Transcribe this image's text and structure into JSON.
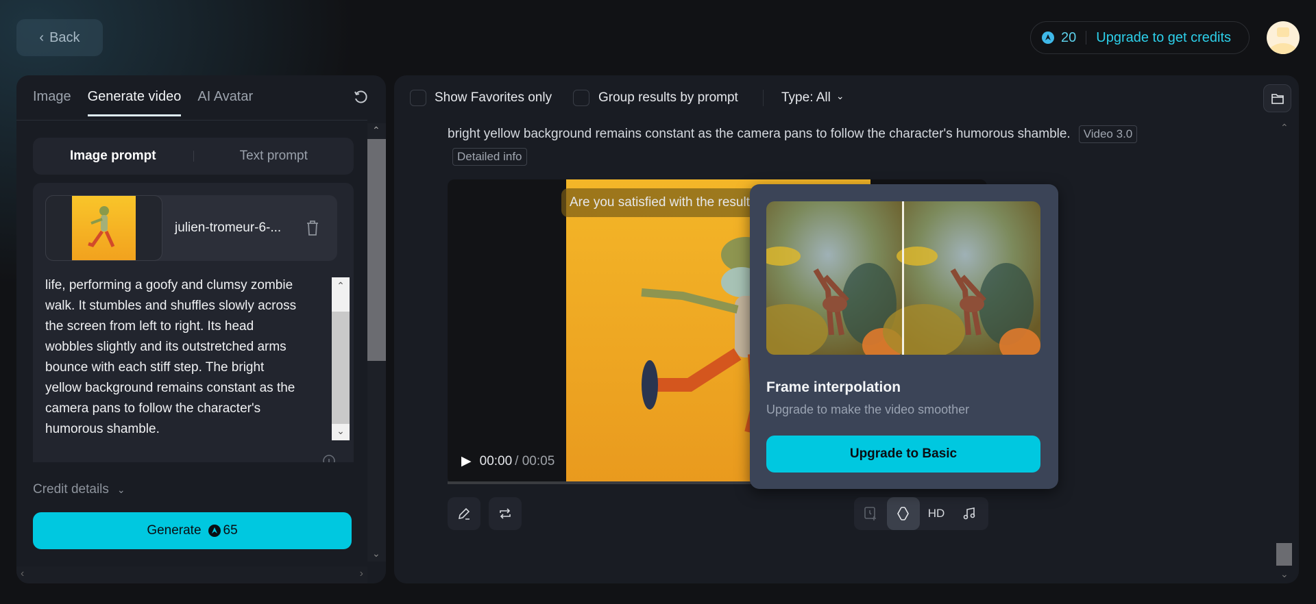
{
  "header": {
    "back_label": "Back",
    "credits": "20",
    "upgrade_label": "Upgrade to get credits"
  },
  "left": {
    "tabs": [
      "Image",
      "Generate video",
      "AI Avatar"
    ],
    "prompt_modes": [
      "Image prompt",
      "Text prompt"
    ],
    "file_name": "julien-tromeur-6-...",
    "prompt_lines": [
      "life, performing a goofy and clumsy zombie",
      "walk. It stumbles and shuffles slowly across",
      "the screen from left to right. Its head",
      "wobbles slightly and its outstretched arms",
      "bounce with each stiff step. The bright",
      "yellow background remains constant as the",
      "camera pans to follow the character's",
      "humorous shamble."
    ],
    "credit_details": "Credit details",
    "generate_label": "Generate",
    "generate_cost": "65"
  },
  "right": {
    "show_favorites": "Show Favorites only",
    "group_by_prompt": "Group results by prompt",
    "type_filter": "Type: All",
    "prompt_text": "bright yellow background remains constant as the camera pans to follow the character's humorous shamble.",
    "model_tag": "Video 3.0",
    "detailed_info": "Detailed info",
    "satisfied": "Are you satisfied with the results?",
    "time_current": "00:00",
    "time_total": "/ 00:05",
    "hd_label": "HD"
  },
  "popup": {
    "title": "Frame interpolation",
    "subtitle": "Upgrade to make the video smoother",
    "button": "Upgrade to Basic"
  },
  "colors": {
    "accent": "#00c8e0",
    "panel": "#191c23",
    "popup": "#3b4457"
  }
}
